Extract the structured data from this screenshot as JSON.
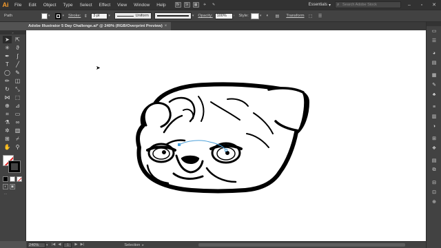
{
  "app": {
    "logo": "Ai"
  },
  "menu": [
    "File",
    "Edit",
    "Object",
    "Type",
    "Select",
    "Effect",
    "View",
    "Window",
    "Help"
  ],
  "menu_icons": [
    "Br",
    "St"
  ],
  "workspace": "Essentials",
  "stock_search_placeholder": "Search Adobe Stock",
  "control": {
    "object_type": "Path",
    "stroke_label": "Stroke:",
    "stroke_weight": "3 pt",
    "profile": "Uniform",
    "opacity_label": "Opacity:",
    "opacity_value": "100%",
    "style_label": "Style:",
    "transform_label": "Transform"
  },
  "document_tab": {
    "title": "Adobe Illustrator 5 Day Challenge.ai* @ 240% (RGB/Overprint Preview)",
    "close": "×"
  },
  "status": {
    "zoom": "240%",
    "page": "1",
    "tool": "Selection"
  },
  "colors": {
    "accent": "#f39a2c",
    "canvas": "#ffffff",
    "ui": "#535353",
    "selection": "#4a9fd8"
  }
}
